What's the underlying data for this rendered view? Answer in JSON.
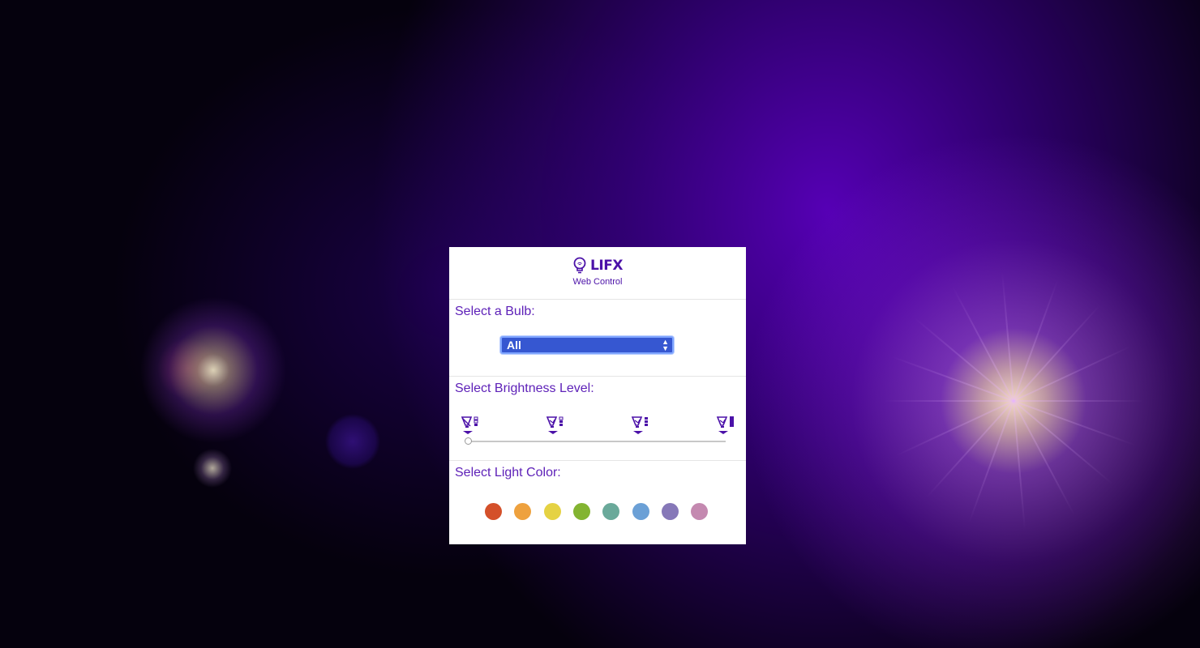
{
  "app": {
    "logo_text": "LIFX",
    "subtitle": "Web Control"
  },
  "bulb_section": {
    "title": "Select a Bulb:",
    "selected": "All"
  },
  "brightness_section": {
    "title": "Select Brightness Level:",
    "levels": [
      {
        "icon": "bulb-brightness-low-icon"
      },
      {
        "icon": "bulb-brightness-medium-icon"
      },
      {
        "icon": "bulb-brightness-high-icon"
      },
      {
        "icon": "bulb-brightness-max-icon"
      }
    ],
    "slider_value": 0
  },
  "color_section": {
    "title": "Select Light Color:",
    "colors": [
      {
        "name": "red",
        "hex": "#d4502a"
      },
      {
        "name": "orange",
        "hex": "#eea13e"
      },
      {
        "name": "yellow",
        "hex": "#e5d243"
      },
      {
        "name": "green",
        "hex": "#83b431"
      },
      {
        "name": "teal",
        "hex": "#6aa99a"
      },
      {
        "name": "blue",
        "hex": "#6ba0d6"
      },
      {
        "name": "purple",
        "hex": "#8678b8"
      },
      {
        "name": "pink",
        "hex": "#c489b0"
      }
    ]
  },
  "theme": {
    "accent": "#5e21b8",
    "select_bg": "#3657d1"
  }
}
